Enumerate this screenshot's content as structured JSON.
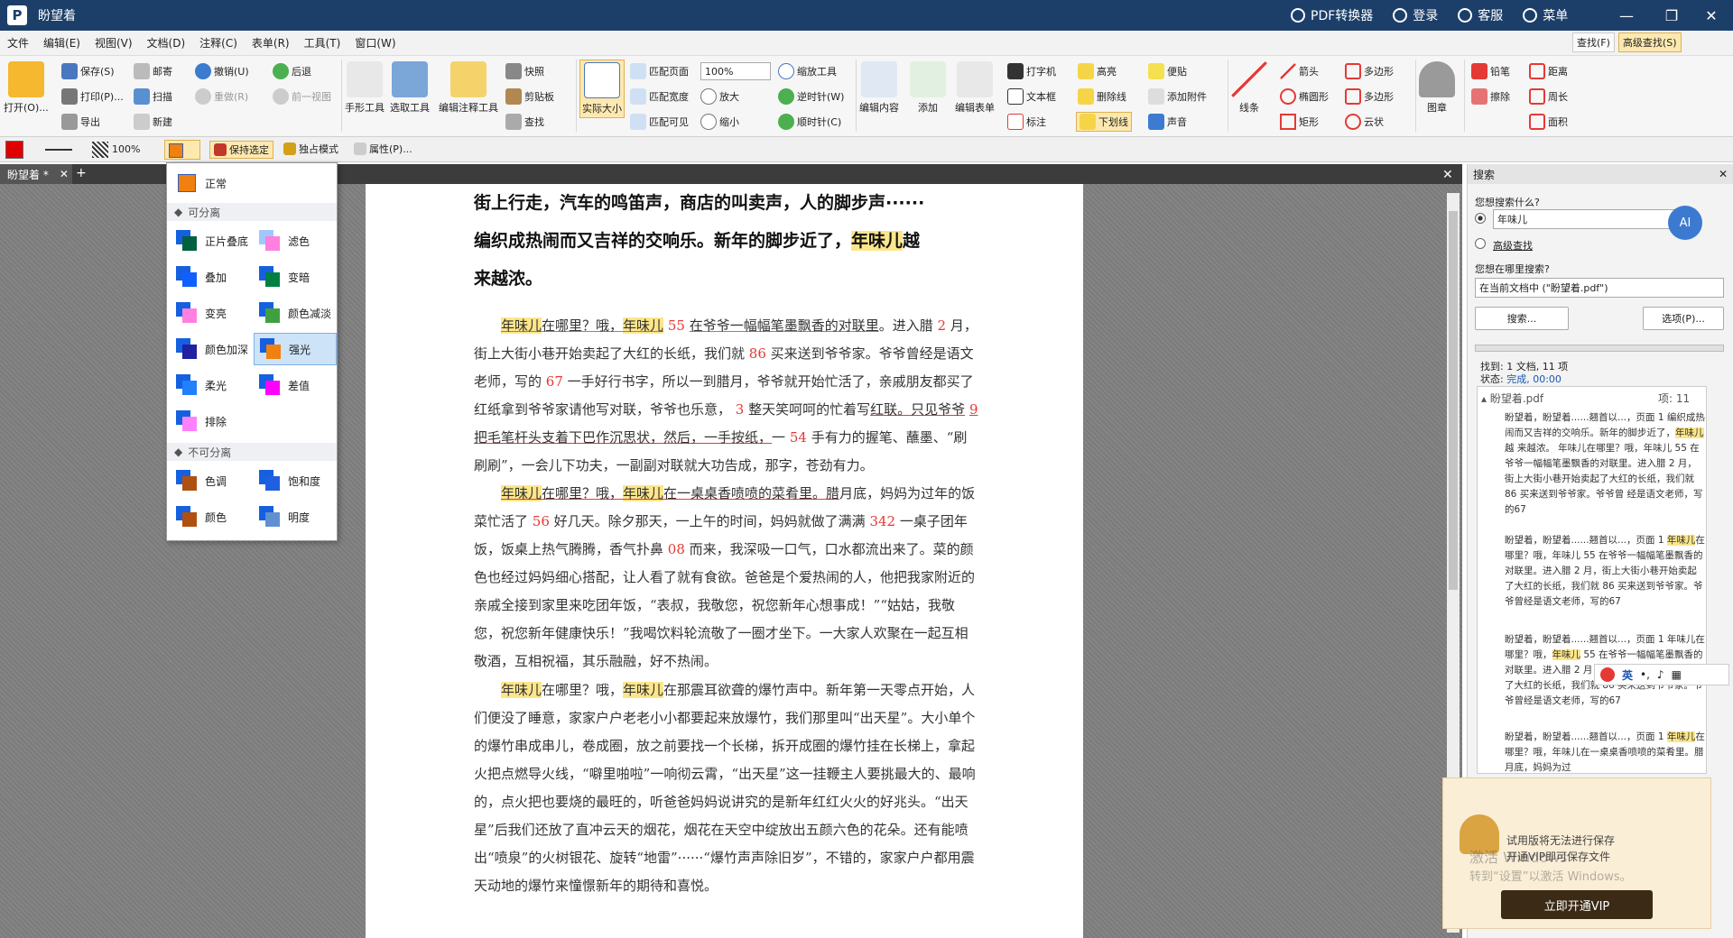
{
  "app": {
    "title": "盼望着",
    "logo_letter": "P"
  },
  "titlebar": {
    "actions": [
      "PDF转换器",
      "登录",
      "客服",
      "菜单"
    ],
    "minimize": "—",
    "restore": "❐",
    "close": "✕"
  },
  "menu": [
    "文件",
    "编辑(E)",
    "视图(V)",
    "文档(D)",
    "注释(C)",
    "表单(R)",
    "工具(T)",
    "窗口(W)"
  ],
  "ribbon": {
    "open": "打开(O)...",
    "save": "保存(S)",
    "print": "打印(P)...",
    "export": "导出",
    "mail": "邮寄",
    "scan": "扫描",
    "new": "新建",
    "undo": "撤销(U)",
    "redo": "重做(R)",
    "back": "后退",
    "prev_view": "前一视图",
    "hand": "手形工具",
    "select": "选取工具",
    "edit_annot": "编辑注释工具",
    "snapshot": "快照",
    "clipboard": "剪贴板",
    "find": "查找",
    "actual_size": "实际大小",
    "fit_page": "匹配页面",
    "fit_width": "匹配宽度",
    "fit_visible": "匹配可见",
    "zoom_value": "100%",
    "zoom_tool": "缩放工具",
    "zoom_in": "放大",
    "zoom_out": "缩小",
    "ccw": "逆时针(W)",
    "cw": "顺时针(C)",
    "edit_content": "编辑内容",
    "add": "添加",
    "edit_form": "编辑表单",
    "typewriter": "打字机",
    "textbox": "文本框",
    "callout": "标注",
    "highlight": "高亮",
    "strikeout": "删除线",
    "underline": "下划线",
    "sticky": "便贴",
    "attach": "添加附件",
    "sound": "声音",
    "line": "线条",
    "arrow": "箭头",
    "ellipse": "椭圆形",
    "rect": "矩形",
    "polygon": "多边形",
    "polyline": "多边形",
    "cloud": "云状",
    "stamp": "图章",
    "pencil": "铅笔",
    "eraser": "擦除",
    "distance": "距离",
    "perimeter": "周长",
    "area": "面积",
    "find_f": "查找(F)",
    "adv_find": "高级查找(S)"
  },
  "toolbar2": {
    "opacity": "100%",
    "keep_selected": "保持选定",
    "exclusive": "独占模式",
    "properties": "属性(P)..."
  },
  "doc_tab": {
    "name": "盼望着 *",
    "add": "+"
  },
  "blend_menu": {
    "normal": "正常",
    "sep_label": "可分离",
    "nonsep_label": "不可分离",
    "separable": [
      "正片叠底",
      "滤色",
      "叠加",
      "变暗",
      "变亮",
      "颜色减淡",
      "颜色加深",
      "强光",
      "柔光",
      "差值",
      "排除"
    ],
    "nonseparable": [
      "色调",
      "饱和度",
      "颜色",
      "明度"
    ],
    "selected": "强光"
  },
  "document": {
    "heading": [
      "街上行走，汽车的鸣笛声，商店的叫卖声，人的脚步声······",
      "编织成热闹而又吉祥的交响乐。新年的脚步近了，",
      "年味儿",
      "越",
      "来越浓。"
    ],
    "p1": [
      "年味儿",
      "在哪里？哦，",
      "年味儿",
      "55",
      "在爷爷一幅幅笔墨飘香的对联里",
      "。进入腊",
      "2",
      "月，街上大街小巷开始卖起了大红的长纸，我们就",
      "86",
      "买来送到爷爷家。爷爷曾经是语文老师，写的",
      "67",
      "一手好行书字，所以一到腊月，爷爷就开始忙活了，亲戚朋友都买了红纸拿到爷爷家请他写对联，爷爷也乐意，",
      "3",
      "整天笑呵呵的忙着写",
      "红联。只见爷爷",
      "9",
      "把毛笔杆头支着下巴作沉思状，然后，一手按纸，",
      "一",
      "54",
      "手有力的握笔、蘸墨、“刷刷刷”，一会儿下功夫，一副副对联就大功告成，那字，苍劲有力。"
    ],
    "p2": [
      "年味儿",
      "在哪里？哦，",
      "年味儿",
      "在一桌桌香喷喷的菜肴里。腊",
      "月底，妈妈为过年的饭菜忙活了",
      "56",
      "好几天。除夕那天，一上午的时间，妈妈就做了满满",
      "342",
      "一桌子团年饭，饭桌上热气腾腾，香气扑鼻",
      "08",
      "而来，我深吸一口气，口水都流出来了。菜的颜色也经过妈妈细心搭配，让人看了就有食欲。爸爸是个爱热闹的人，他把我家附近的亲戚全接到家里来吃团年饭，“表叔，我敬您，祝您新年心想事成！”“姑姑，我敬您，祝您新年健康快乐！”我喝饮料轮流敬了一圈才坐下。一大家人欢聚在一起互相敬酒，互相祝福，其乐融融，好不热闹。"
    ],
    "p3": [
      "年味儿",
      "在哪里？哦，",
      "年味儿",
      "在那震耳欲聋的爆竹声中。新年第一天零点开始，人们便没了睡意，家家户户老老小小都要起来放爆竹，我们那里叫“出天星”。大小单个的爆竹串成串儿，卷成圈，放之前要找一个长梯，拆开成圈的爆竹挂在长梯上，拿起火把点燃导火线，“噼里啪啦”一响彻云霄，“出天星”这一挂鞭主人要挑最大的、最响的，点火把也要烧的最旺的，听爸爸妈妈说讲究的是新年红红火火的好兆头。“出天星”后我们还放了直冲云天的烟花，烟花在天空中绽放出五颜六色的花朵。还有能喷出“喷泉”的火树银花、旋转“地雷”······“爆竹声声除旧岁”，不错的，家家户户都用震天动地的爆竹来憧憬新年的期待和喜悦。"
    ]
  },
  "search": {
    "title": "搜索",
    "close": "✕",
    "q_label": "您想搜索什么?",
    "query": "年味儿",
    "advanced": "高级查找",
    "where_label": "您想在哪里搜索?",
    "where": "在当前文档中 (\"盼望着.pdf\")",
    "search_btn": "搜索...",
    "options_btn": "选项(P)...",
    "found": "找到: 1 文档, 11 项",
    "status_label": "状态: ",
    "status": "完成, 00:00",
    "file": "盼望着.pdf",
    "count": "项: 11",
    "results": [
      [
        "盼望着，盼望着......翘首以...，页面 1 编织成热闹而又吉祥的交响乐。新年的脚步近了，",
        "年味儿",
        "越 来越浓。 年味儿在哪里？哦，年味儿 55 在爷爷一幅幅笔墨飘香的对联里。进入腊 2 月，街上大街小巷开始卖起了大红的长纸，我们就 86 买来送到爷爷家。爷爷曾 经是语文老师，写的67"
      ],
      [
        "盼望着，盼望着......翘首以...，页面 1 ",
        "年味儿",
        "在哪里？哦，年味儿 55 在爷爷一幅幅笔墨飘香的对联里。进入腊 2 月，街上大街小巷开始卖起了大红的长纸，我们就 86 买来送到爷爷家。爷爷曾经是语文老师，写的67"
      ],
      [
        "盼望着，盼望着......翘首以...，页面 1 年味儿在哪里？哦，",
        "年味儿",
        " 55 在爷爷一幅幅笔墨飘香的对联里。进入腊 2 月，街上大街小巷开始卖起了大红的长纸，我们就 86 买来送到爷爷家。爷爷曾经是语文老师，写的67"
      ],
      [
        "盼望着，盼望着......翘首以...，页面 1 ",
        "年味儿",
        "在哪里？哦，年味儿在一桌桌香喷喷的菜肴里。腊月底，妈妈为过"
      ]
    ]
  },
  "vip": {
    "line1": "试用版将无法进行保存",
    "line2": "开通VIP即可保存文件",
    "button": "立即开通VIP"
  },
  "watermark": {
    "line1": "激活 Windows",
    "line2": "转到“设置”以激活 Windows。"
  },
  "ime": {
    "label": "英"
  }
}
